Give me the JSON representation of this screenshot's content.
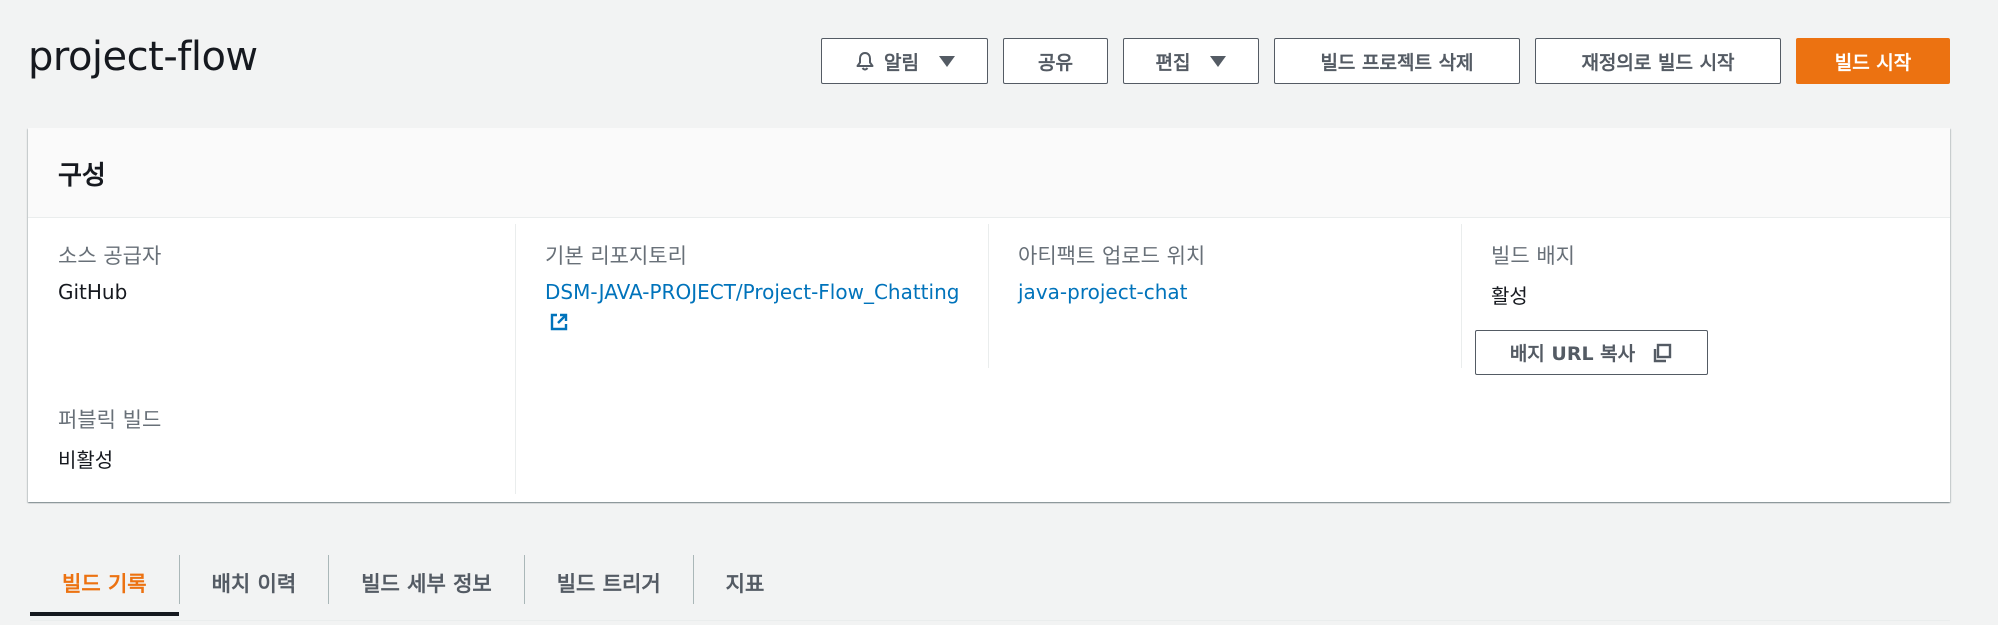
{
  "header": {
    "title": "project-flow"
  },
  "actions": {
    "notify_label": "알림",
    "share_label": "공유",
    "edit_label": "편집",
    "delete_label": "빌드 프로젝트 삭제",
    "restart_label": "재정의로 빌드 시작",
    "start_label": "빌드 시작"
  },
  "config": {
    "title": "구성",
    "source_provider": {
      "label": "소스 공급자",
      "value": "GitHub"
    },
    "primary_repo": {
      "label": "기본 리포지토리",
      "value": "DSM-JAVA-PROJECT/Project-Flow_Chatting"
    },
    "artifact": {
      "label": "아티팩트 업로드 위치",
      "value": "java-project-chat"
    },
    "build_badge": {
      "label": "빌드 배지",
      "value": "활성",
      "copy_button": "배지 URL 복사"
    },
    "public_build": {
      "label": "퍼블릭 빌드",
      "value": "비활성"
    }
  },
  "tabs": [
    {
      "label": "빌드 기록",
      "active": true
    },
    {
      "label": "배치 이력",
      "active": false
    },
    {
      "label": "빌드 세부 정보",
      "active": false
    },
    {
      "label": "빌드 트리거",
      "active": false
    },
    {
      "label": "지표",
      "active": false
    }
  ],
  "colors": {
    "primary": "#ec7211",
    "link": "#0073bb",
    "text": "#16191f",
    "muted": "#687078"
  }
}
